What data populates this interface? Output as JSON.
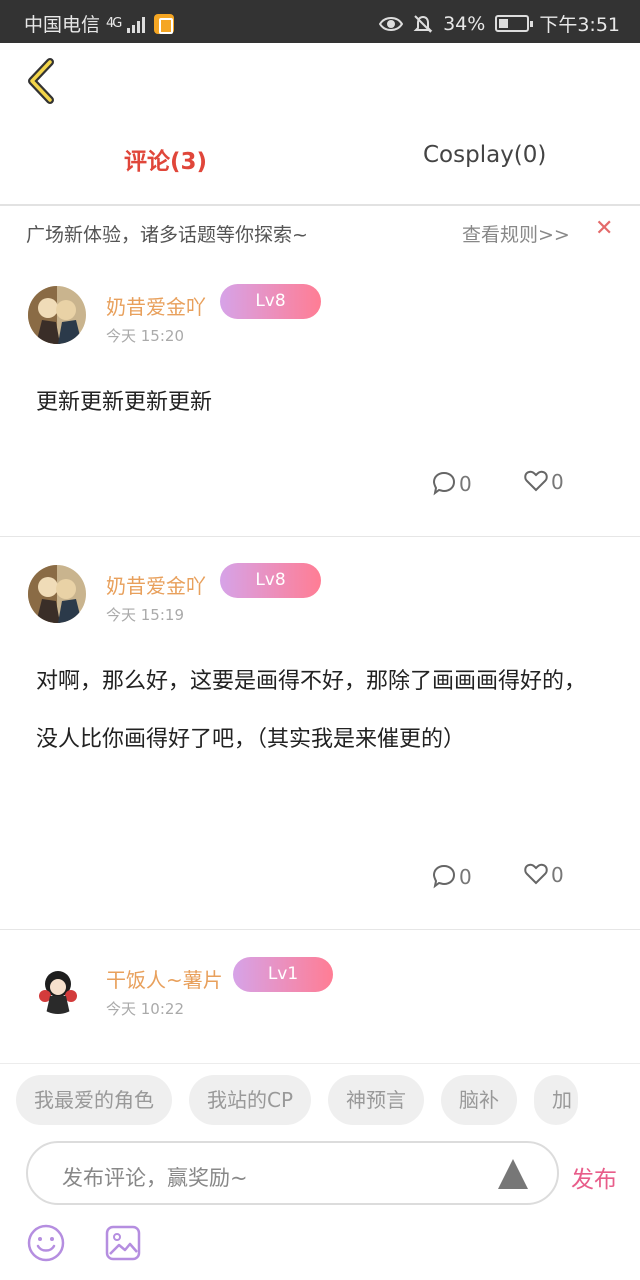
{
  "status_bar": {
    "carrier": "中国电信",
    "network": "4G",
    "battery": "34%",
    "time": "下午3:51",
    "battery_level": 0.34
  },
  "tabs": [
    {
      "label": "评论(3)",
      "active": true
    },
    {
      "label": "Cosplay(0)",
      "active": false
    }
  ],
  "notice": {
    "text": "广场新体验，诸多话题等你探索~",
    "link": "查看规则>>",
    "close_icon": "close-icon"
  },
  "comments": [
    {
      "username": "奶昔爱金吖",
      "level": "Lv8",
      "time": "今天  15:20",
      "content": "更新更新更新更新",
      "reply_count": "0",
      "like_count": "0"
    },
    {
      "username": "奶昔爱金吖",
      "level": "Lv8",
      "time": "今天  15:19",
      "content": "对啊，那么好，这要是画得不好，那除了画画画得好的，没人比你画得好了吧，（其实我是来催更的）",
      "reply_count": "0",
      "like_count": "0"
    },
    {
      "username": "干饭人~薯片",
      "level": "Lv1",
      "time": "今天  10:22"
    }
  ],
  "topic_chips": [
    "我最爱的角色",
    "我站的CP",
    "神预言",
    "脑补",
    "加"
  ],
  "composer": {
    "placeholder": "发布评论，赢奖励~",
    "publish_label": "发布"
  },
  "colors": {
    "active_tab": "#e0463a",
    "username": "#e8a05c",
    "level_gradient_start": "#d6a3e8",
    "level_gradient_end": "#ff7d94",
    "publish": "#e85d8a"
  }
}
